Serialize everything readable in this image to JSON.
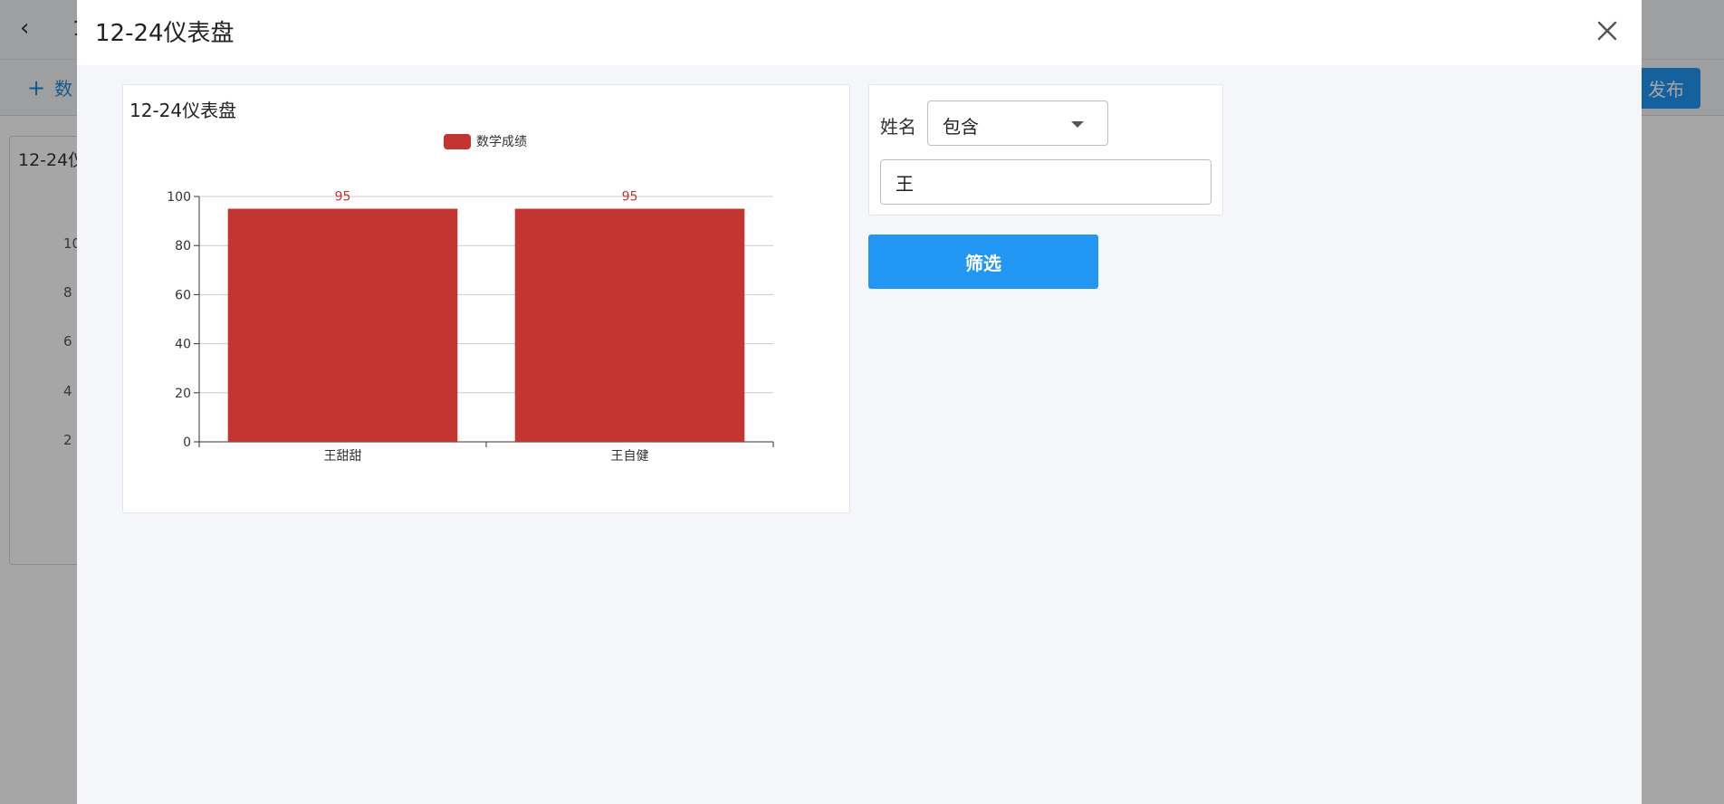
{
  "background": {
    "back_icon": "‹",
    "title": "1",
    "add_label": "数",
    "publish_label": "发布",
    "card_title": "12-24仪",
    "ticks": [
      "10",
      "8",
      "6",
      "4",
      "2"
    ]
  },
  "modal": {
    "title": "12-24仪表盘",
    "close_icon": "close-icon"
  },
  "chart": {
    "card_title": "12-24仪表盘"
  },
  "chart_data": {
    "type": "bar",
    "categories": [
      "王甜甜",
      "王自健"
    ],
    "series": [
      {
        "name": "数学成绩",
        "values": [
          95,
          95
        ],
        "color": "#c23531"
      }
    ],
    "ylim": [
      0,
      100
    ],
    "yticks": [
      0,
      20,
      40,
      60,
      80,
      100
    ],
    "grid": true,
    "legend": "top-center",
    "data_labels": true
  },
  "filter": {
    "field_label": "姓名",
    "operator": "包含",
    "value": "王",
    "button_label": "筛选"
  },
  "colors": {
    "accent": "#2196f3",
    "bar": "#c23531"
  }
}
